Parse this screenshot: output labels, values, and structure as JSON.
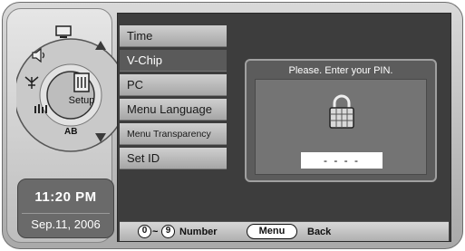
{
  "sidebar": {
    "selected_icon_label": "Setup",
    "ab_label": "AB",
    "icons": [
      "monitor-icon",
      "speaker-icon",
      "antenna-icon",
      "channel-icon",
      "setup-icon",
      "ab-icon"
    ]
  },
  "clock": {
    "time": "11:20 PM",
    "date": "Sep.11, 2006"
  },
  "menu": {
    "items": [
      {
        "label": "Time"
      },
      {
        "label": "V-Chip"
      },
      {
        "label": "PC"
      },
      {
        "label": "Menu Language"
      },
      {
        "label": "Menu Transparency"
      },
      {
        "label": "Set ID"
      }
    ]
  },
  "dialog": {
    "message": "Please. Enter your PIN.",
    "pin_value": "- - - -"
  },
  "footer": {
    "num_start": "0",
    "num_end": "9",
    "num_label": "Number",
    "menu_button": "Menu",
    "menu_label": "Back",
    "tilde": "~"
  }
}
